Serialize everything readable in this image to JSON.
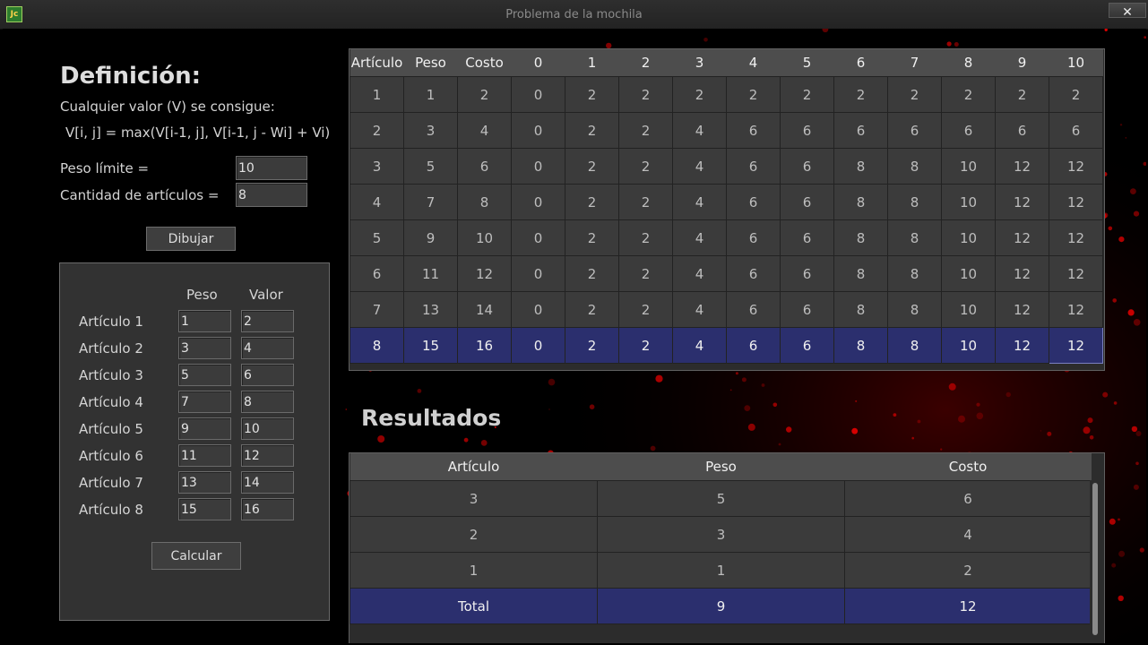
{
  "window": {
    "title": "Problema de la mochila",
    "icon_text": "Jc",
    "close_label": "✕"
  },
  "definition": {
    "title": "Definición:",
    "subtitle": "Cualquier valor (V) se consigue:",
    "formula": "V[i, j] = max(V[i-1, j], V[i-1, j - Wi] + Vi)",
    "weight_limit_label": "Peso límite =",
    "weight_limit_value": "10",
    "item_count_label": "Cantidad de artículos =",
    "item_count_value": "8",
    "draw_button": "Dibujar"
  },
  "items_panel": {
    "header_weight": "Peso",
    "header_value": "Valor",
    "items": [
      {
        "label": "Artículo 1",
        "weight": "1",
        "value": "2"
      },
      {
        "label": "Artículo 2",
        "weight": "3",
        "value": "4"
      },
      {
        "label": "Artículo 3",
        "weight": "5",
        "value": "6"
      },
      {
        "label": "Artículo 4",
        "weight": "7",
        "value": "8"
      },
      {
        "label": "Artículo 5",
        "weight": "9",
        "value": "10"
      },
      {
        "label": "Artículo 6",
        "weight": "11",
        "value": "12"
      },
      {
        "label": "Artículo 7",
        "weight": "13",
        "value": "14"
      },
      {
        "label": "Artículo 8",
        "weight": "15",
        "value": "16"
      }
    ],
    "calculate_button": "Calcular"
  },
  "dp_table": {
    "headers": [
      "Artículo",
      "Peso",
      "Costo",
      "0",
      "1",
      "2",
      "3",
      "4",
      "5",
      "6",
      "7",
      "8",
      "9",
      "10"
    ],
    "rows": [
      [
        "1",
        "1",
        "2",
        "0",
        "2",
        "2",
        "2",
        "2",
        "2",
        "2",
        "2",
        "2",
        "2",
        "2"
      ],
      [
        "2",
        "3",
        "4",
        "0",
        "2",
        "2",
        "4",
        "6",
        "6",
        "6",
        "6",
        "6",
        "6",
        "6"
      ],
      [
        "3",
        "5",
        "6",
        "0",
        "2",
        "2",
        "4",
        "6",
        "6",
        "8",
        "8",
        "10",
        "12",
        "12"
      ],
      [
        "4",
        "7",
        "8",
        "0",
        "2",
        "2",
        "4",
        "6",
        "6",
        "8",
        "8",
        "10",
        "12",
        "12"
      ],
      [
        "5",
        "9",
        "10",
        "0",
        "2",
        "2",
        "4",
        "6",
        "6",
        "8",
        "8",
        "10",
        "12",
        "12"
      ],
      [
        "6",
        "11",
        "12",
        "0",
        "2",
        "2",
        "4",
        "6",
        "6",
        "8",
        "8",
        "10",
        "12",
        "12"
      ],
      [
        "7",
        "13",
        "14",
        "0",
        "2",
        "2",
        "4",
        "6",
        "6",
        "8",
        "8",
        "10",
        "12",
        "12"
      ],
      [
        "8",
        "15",
        "16",
        "0",
        "2",
        "2",
        "4",
        "6",
        "6",
        "8",
        "8",
        "10",
        "12",
        "12"
      ]
    ],
    "selected_row": 7
  },
  "results": {
    "title": "Resultados",
    "headers": [
      "Artículo",
      "Peso",
      "Costo"
    ],
    "rows": [
      [
        "3",
        "5",
        "6"
      ],
      [
        "2",
        "3",
        "4"
      ],
      [
        "1",
        "1",
        "2"
      ]
    ],
    "total": [
      "Total",
      "9",
      "12"
    ]
  },
  "colors": {
    "background": "#000000",
    "panel": "#323232",
    "cell": "#3b3b3b",
    "header": "#4d4d4d",
    "selection": "#2b2f6e",
    "accent_red": "#c40000"
  }
}
